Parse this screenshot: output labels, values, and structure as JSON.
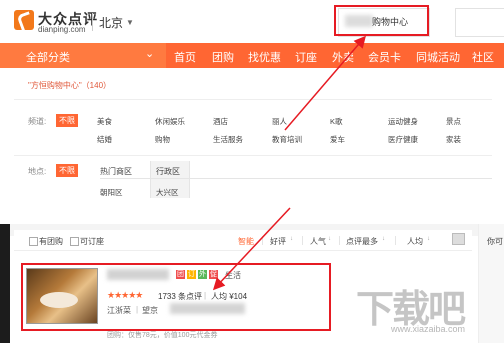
{
  "header": {
    "logo_cn": "大众点评",
    "logo_en": "dianping.com",
    "city": "北京",
    "search_value": "购物中心"
  },
  "nav": {
    "all_categories": "全部分类",
    "items": [
      "首页",
      "团购",
      "找优惠",
      "订座",
      "外卖",
      "会员卡",
      "同城活动",
      "社区"
    ]
  },
  "breadcrumb": "\"方恒购物中心\"（140）",
  "filters": {
    "category_label": "频道:",
    "unlimited": "不限",
    "categories": [
      "美食",
      "休闲娱乐",
      "酒店",
      "丽人",
      "K歌",
      "运动健身",
      "景点",
      "结婚",
      "购物",
      "生活服务",
      "教育培训",
      "爱车",
      "医疗健康",
      "家装"
    ],
    "area_label": "地点:",
    "area_tabs": [
      "热门商区",
      "行政区"
    ],
    "districts": [
      "朝阳区",
      "大兴区"
    ]
  },
  "sort": {
    "has_groupbuy": "有团购",
    "bookable": "可订座",
    "smart": "智能",
    "rating": "好评",
    "popularity": "人气",
    "reviews": "点评最多",
    "avg_price": "人均",
    "right_text": "你可"
  },
  "shop": {
    "badges": [
      "团",
      "订",
      "外",
      "促"
    ],
    "category": "生活",
    "stars": "★★★★★",
    "reviews": "1733 条点评",
    "avg": "人均 ¥104",
    "district": "江浙菜",
    "address_prefix": "望京",
    "promo": "团购：仅售78元，价值100元代金券"
  },
  "watermark": {
    "text": "下载吧",
    "url": "www.xiazaiba.com"
  },
  "colors": {
    "brand": "#ff6633",
    "highlight": "#e61b23"
  }
}
